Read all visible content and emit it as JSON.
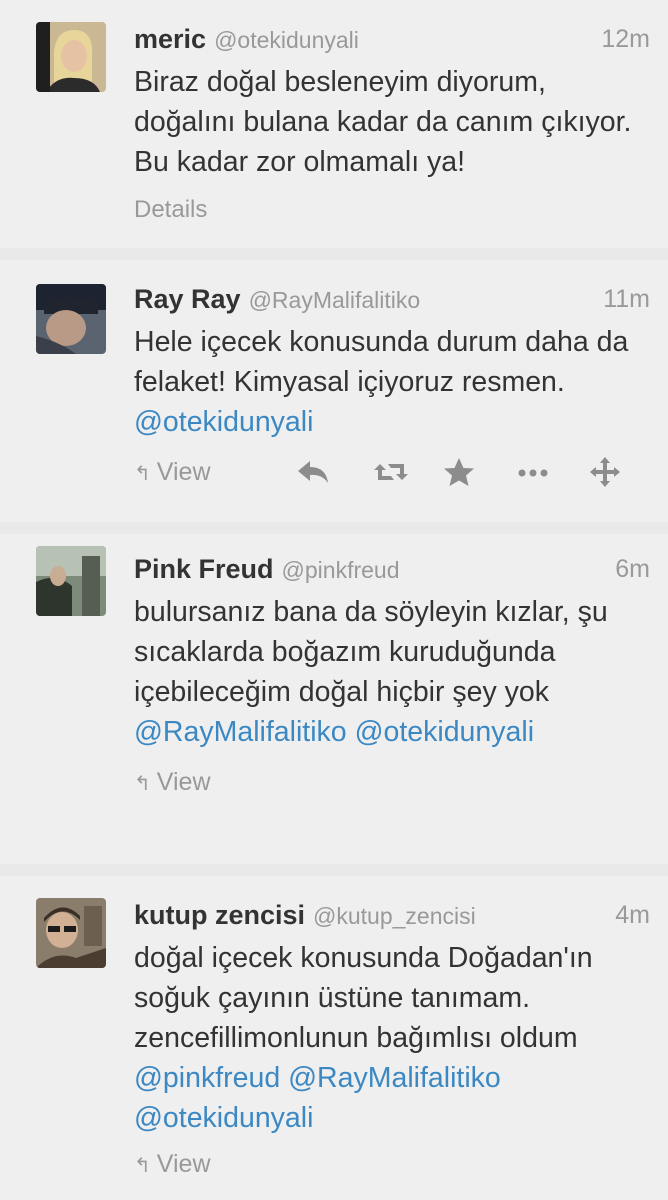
{
  "tweets": [
    {
      "name": "meric",
      "handle": "@otekidunyali",
      "time": "12m",
      "text": [
        {
          "t": "Biraz doğal besleneyim diyorum, doğalını bulana kadar da canım çıkıyor. Bu kadar zor olmamalı ya!",
          "m": false
        }
      ],
      "details_label": "Details"
    },
    {
      "name": "Ray Ray",
      "handle": "@RayMalifalitiko",
      "time": "11m",
      "text": [
        {
          "t": "Hele içecek konusunda durum daha da felaket! Kimyasal içiyoruz resmen. ",
          "m": false
        },
        {
          "t": "@otekidunyali",
          "m": true
        }
      ],
      "view_label": "View",
      "action_icons": [
        "reply-icon",
        "retweet-icon",
        "favorite-icon",
        "more-icon",
        "expand-icon"
      ]
    },
    {
      "name": "Pink Freud",
      "handle": "@pinkfreud",
      "time": "6m",
      "text": [
        {
          "t": "bulursanız bana da söyleyin kızlar, şu sıcaklarda boğazım kuruduğunda içebileceğim doğal hiçbir şey yok ",
          "m": false
        },
        {
          "t": "@RayMalifalitiko",
          "m": true
        },
        {
          "t": " ",
          "m": false
        },
        {
          "t": "@otekidunyali",
          "m": true
        }
      ],
      "view_label": "View"
    },
    {
      "name": "kutup zencisi",
      "handle": "@kutup_zencisi",
      "time": "4m",
      "text": [
        {
          "t": "doğal içecek konusunda Doğadan'ın soğuk çayının üstüne tanımam. zencefillimonlunun bağımlısı oldum ",
          "m": false
        },
        {
          "t": "@pinkfreud",
          "m": true
        },
        {
          "t": " ",
          "m": false
        },
        {
          "t": "@RayMalifalitiko",
          "m": true
        },
        {
          "t": " ",
          "m": false
        },
        {
          "t": "@otekidunyali",
          "m": true
        }
      ],
      "view_label": "View"
    }
  ],
  "colors": {
    "background": "#e9e9e9",
    "card": "#efefef",
    "text": "#333333",
    "muted": "#999999",
    "link": "#3b88c3"
  }
}
